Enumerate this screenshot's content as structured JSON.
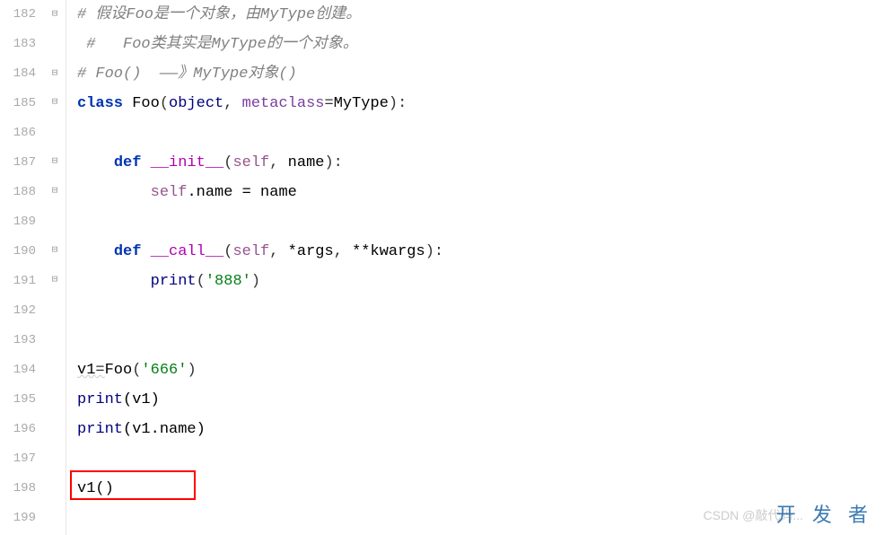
{
  "lines": {
    "start": 182,
    "numbers": [
      "182",
      "183",
      "184",
      "185",
      "186",
      "187",
      "188",
      "189",
      "190",
      "191",
      "192",
      "193",
      "194",
      "195",
      "196",
      "197",
      "198",
      "199"
    ]
  },
  "code": {
    "l182_comment": "# 假设Foo是一个对象，由MyType创建。",
    "l183_comment": "#   Foo类其实是MyType的一个对象。",
    "l184_comment": "# Foo()  ——》MyType对象()",
    "l185_class": "class",
    "l185_foo": "Foo",
    "l185_object": "object",
    "l185_metaclass": "metaclass",
    "l185_mytype": "MyType",
    "l187_def": "def",
    "l187_init": "__init__",
    "l187_self": "self",
    "l187_name": "name",
    "l188_self": "self",
    "l188_attr": ".name = name",
    "l190_def": "def",
    "l190_call": "__call__",
    "l190_self": "self",
    "l190_args": "*args",
    "l190_kwargs": "**kwargs",
    "l191_print": "print",
    "l191_str": "'888'",
    "l194_v1": "v1",
    "l194_eq": "=",
    "l194_foo": "Foo",
    "l194_str": "'666'",
    "l195_print": "print",
    "l195_arg": "(v1)",
    "l196_print": "print",
    "l196_arg": "(v1.name)",
    "l198": "v1()"
  },
  "watermarks": {
    "csdn": "CSDN @敲代码...",
    "devze": "开 发 者"
  }
}
